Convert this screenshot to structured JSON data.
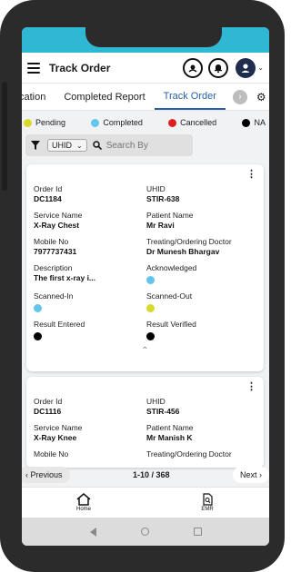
{
  "header": {
    "title": "Track Order"
  },
  "tabs": [
    {
      "label": "cation"
    },
    {
      "label": "Completed Report"
    },
    {
      "label": "Track Order"
    }
  ],
  "legend": [
    {
      "label": "Pending",
      "color": "#d9d92a"
    },
    {
      "label": "Completed",
      "color": "#63c4ec"
    },
    {
      "label": "Cancelled",
      "color": "#e02020"
    },
    {
      "label": "NA",
      "color": "#000000"
    }
  ],
  "filter": {
    "field": "UHID",
    "placeholder": "Search By"
  },
  "orders": [
    {
      "order_id_label": "Order Id",
      "order_id": "DC1184",
      "uhid_label": "UHID",
      "uhid": "STIR-638",
      "service_label": "Service Name",
      "service": "X-Ray Chest",
      "patient_label": "Patient Name",
      "patient": "Mr Ravi",
      "mobile_label": "Mobile No",
      "mobile": "7977737431",
      "doctor_label": "Treating/Ordering Doctor",
      "doctor": "Dr Munesh Bhargav",
      "description_label": "Description",
      "description": "The first x-ray i...",
      "acknowledged_label": "Acknowledged",
      "acknowledged_color": "#63c4ec",
      "scanned_in_label": "Scanned-In",
      "scanned_in_color": "#63c4ec",
      "scanned_out_label": "Scanned-Out",
      "scanned_out_color": "#d9d92a",
      "result_entered_label": "Result Entered",
      "result_entered_color": "#000000",
      "result_verified_label": "Result Verified",
      "result_verified_color": "#000000"
    },
    {
      "order_id_label": "Order Id",
      "order_id": "DC1116",
      "uhid_label": "UHID",
      "uhid": "STIR-456",
      "service_label": "Service Name",
      "service": "X-Ray Knee",
      "patient_label": "Patient Name",
      "patient": "Mr Manish K",
      "mobile_label": "Mobile No",
      "doctor_label": "Treating/Ordering Doctor"
    }
  ],
  "pagination": {
    "prev": "Previous",
    "range": "1-10 / 368",
    "next": "Next"
  },
  "bottom_nav": [
    {
      "label": "Home",
      "icon": "home-icon"
    },
    {
      "label": "EMR",
      "icon": "document-search-icon"
    }
  ],
  "colors": {
    "status_bar": "#2fb7d4",
    "active_tab": "#2a5fa8"
  }
}
